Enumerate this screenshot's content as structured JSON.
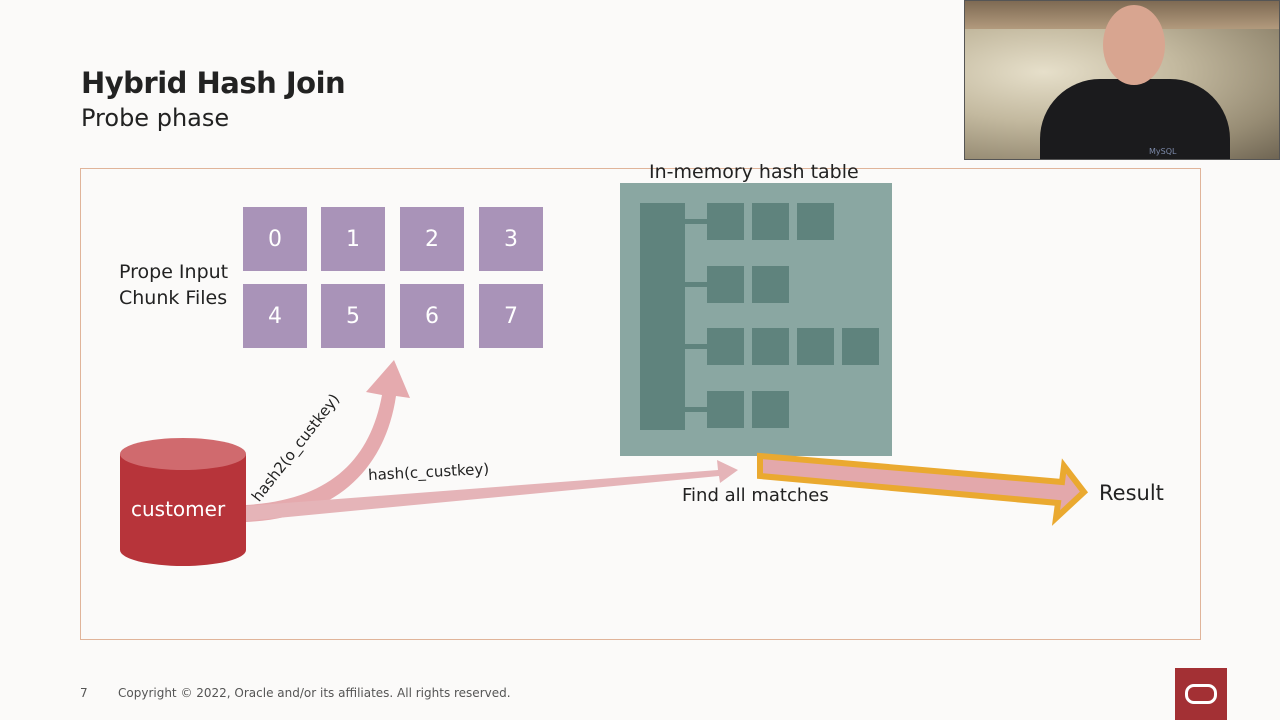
{
  "slide": {
    "title": "Hybrid Hash Join",
    "subtitle": "Probe phase",
    "page_number": "7",
    "copyright": "Copyright © 2022, Oracle and/or its affiliates. All rights reserved."
  },
  "diagram": {
    "chunk_files_label_line1": "Prope Input",
    "chunk_files_label_line2": "Chunk Files",
    "chunks": [
      "0",
      "1",
      "2",
      "3",
      "4",
      "5",
      "6",
      "7"
    ],
    "hash_table_title": "In-memory hash table",
    "hash_table_buckets": [
      3,
      2,
      4,
      2
    ],
    "source_table": "customer",
    "arrow_hash2_label": "hash2(o_custkey)",
    "arrow_hash_label": "hash(c_custkey)",
    "find_label": "Find all matches",
    "result_label": "Result",
    "colors": {
      "chunk": "#a993b8",
      "hash_table_bg": "#8aa7a2",
      "hash_table_fg": "#5f837d",
      "cylinder": "#b7343a",
      "arrow_pink": "#e5aaae",
      "result_arrow_outline": "#eaa930",
      "frame_border": "#e0b49a"
    }
  },
  "webcam": {
    "shirt_brand": "MySQL"
  },
  "logo": "oracle-logo"
}
